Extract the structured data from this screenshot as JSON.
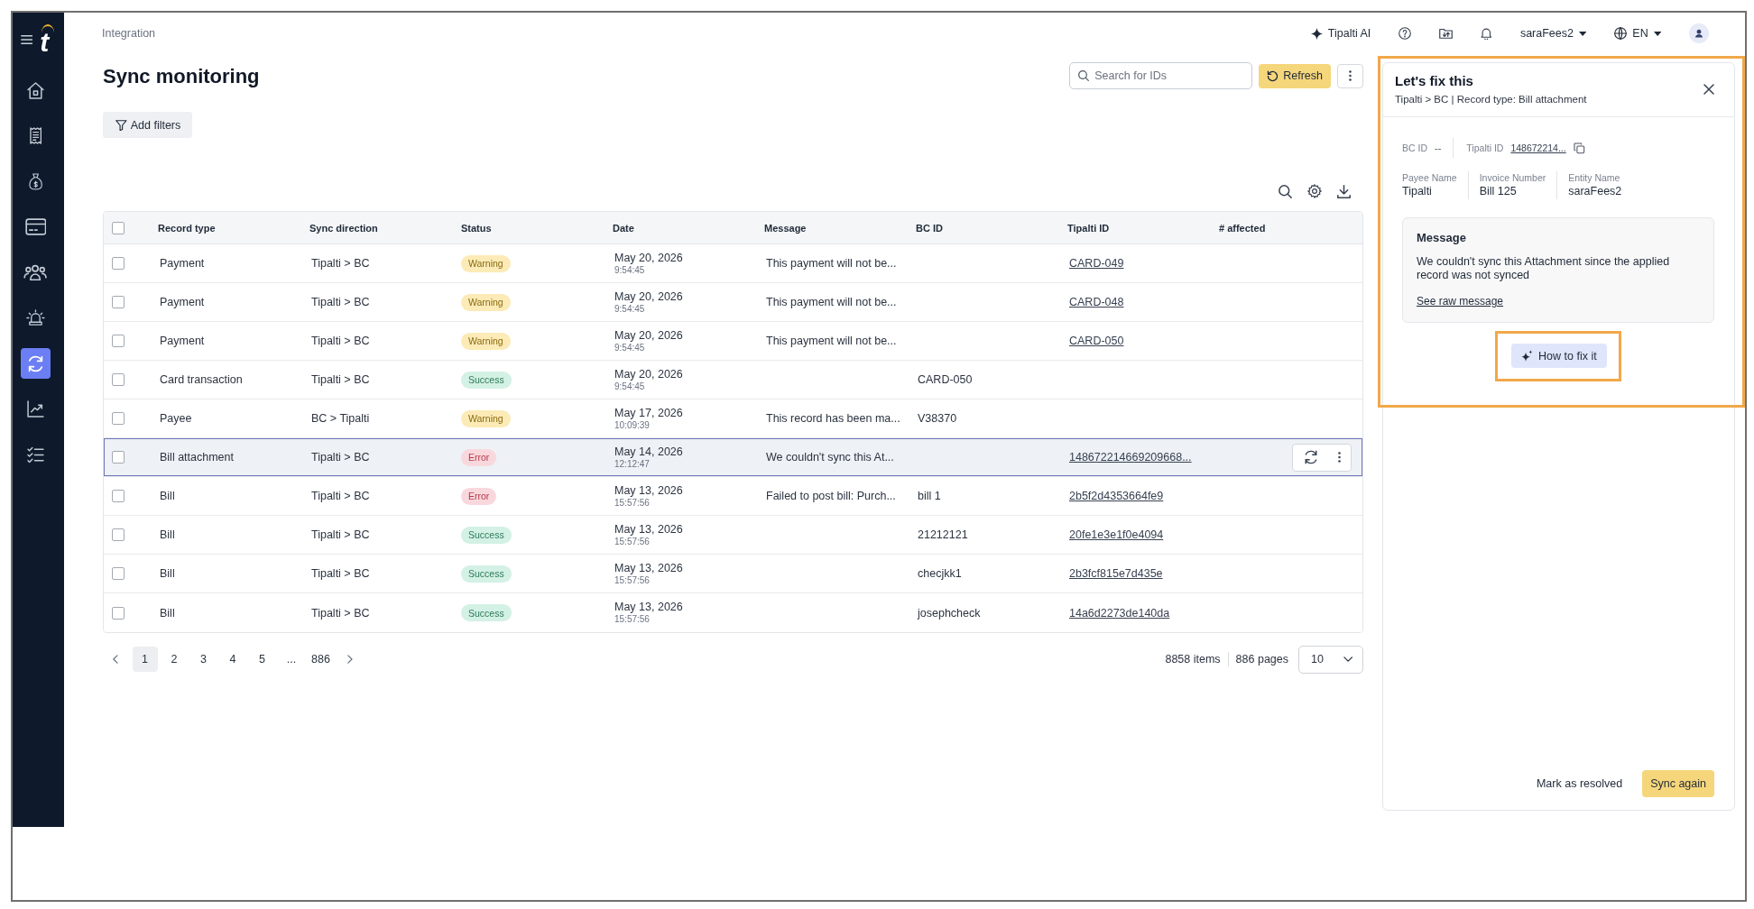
{
  "sidebar": {
    "logo": "t",
    "items": [
      {
        "kind": "home",
        "selected": false
      },
      {
        "kind": "receipt",
        "selected": false
      },
      {
        "kind": "moneybag",
        "selected": false
      },
      {
        "kind": "card",
        "selected": false
      },
      {
        "kind": "people",
        "selected": false
      },
      {
        "kind": "alarm",
        "selected": false
      },
      {
        "kind": "sync",
        "selected": true
      },
      {
        "kind": "chart",
        "selected": false
      },
      {
        "kind": "checklist",
        "selected": false
      }
    ]
  },
  "top_bar": {
    "breadcrumb": "Integration",
    "ai_button": "Tipalti AI",
    "account_menu": "saraFees2",
    "language_menu": "EN"
  },
  "page": {
    "title": "Sync monitoring",
    "search": {
      "placeholder": "Search for IDs"
    },
    "refresh_button": "Refresh",
    "add_filters_button": "Add filters"
  },
  "table": {
    "header_checked": false,
    "columns": [
      "Record type",
      "Sync direction",
      "Status",
      "Date",
      "Message",
      "BC ID",
      "Tipalti ID",
      "# affected"
    ],
    "rows": [
      {
        "checked": false,
        "selected": false,
        "record_type": "Payment",
        "sync_direction": "Tipalti > BC",
        "status": {
          "kind": "warning",
          "label": "Warning"
        },
        "date": "May 20, 2026",
        "time": "9:54:45",
        "message": "This payment will not be...",
        "tipalti_id": "CARD-049"
      },
      {
        "checked": false,
        "selected": false,
        "record_type": "Payment",
        "sync_direction": "Tipalti > BC",
        "status": {
          "kind": "warning",
          "label": "Warning"
        },
        "date": "May 20, 2026",
        "time": "9:54:45",
        "message": "This payment will not be...",
        "tipalti_id": "CARD-048"
      },
      {
        "checked": false,
        "selected": false,
        "record_type": "Payment",
        "sync_direction": "Tipalti > BC",
        "status": {
          "kind": "warning",
          "label": "Warning"
        },
        "date": "May 20, 2026",
        "time": "9:54:45",
        "message": "This payment will not be...",
        "tipalti_id": "CARD-050"
      },
      {
        "checked": false,
        "selected": false,
        "record_type": "Card transaction",
        "sync_direction": "Tipalti > BC",
        "status": {
          "kind": "success",
          "label": "Success"
        },
        "date": "May 20, 2026",
        "time": "9:54:45",
        "bc_id": "CARD-050"
      },
      {
        "checked": false,
        "selected": false,
        "record_type": "Payee",
        "sync_direction": "BC > Tipalti",
        "status": {
          "kind": "warning",
          "label": "Warning"
        },
        "date": "May 17, 2026",
        "time": "10:09:39",
        "message": "This record has been ma...",
        "bc_id": "V38370"
      },
      {
        "checked": false,
        "selected": true,
        "record_type": "Bill attachment",
        "sync_direction": "Tipalti > BC",
        "status": {
          "kind": "error",
          "label": "Error"
        },
        "date": "May 14, 2026",
        "time": "12:12:47",
        "message": "We couldn't sync this At...",
        "tipalti_id": "148672214669209668..."
      },
      {
        "checked": false,
        "selected": false,
        "record_type": "Bill",
        "sync_direction": "Tipalti > BC",
        "status": {
          "kind": "error",
          "label": "Error"
        },
        "date": "May 13, 2026",
        "time": "15:57:56",
        "message": "Failed to post bill: Purch...",
        "bc_id": "bill 1",
        "tipalti_id": "2b5f2d4353664fe9"
      },
      {
        "checked": false,
        "selected": false,
        "record_type": "Bill",
        "sync_direction": "Tipalti > BC",
        "status": {
          "kind": "success",
          "label": "Success"
        },
        "date": "May 13, 2026",
        "time": "15:57:56",
        "bc_id": "21212121",
        "tipalti_id": "20fe1e3e1f0e4094"
      },
      {
        "checked": false,
        "selected": false,
        "record_type": "Bill",
        "sync_direction": "Tipalti > BC",
        "status": {
          "kind": "success",
          "label": "Success"
        },
        "date": "May 13, 2026",
        "time": "15:57:56",
        "bc_id": "checjkk1",
        "tipalti_id": "2b3fcf815e7d435e"
      },
      {
        "checked": false,
        "selected": false,
        "record_type": "Bill",
        "sync_direction": "Tipalti > BC",
        "status": {
          "kind": "success",
          "label": "Success"
        },
        "date": "May 13, 2026",
        "time": "15:57:56",
        "bc_id": "josephcheck",
        "tipalti_id": "14a6d2273de140da"
      }
    ]
  },
  "pagination": {
    "pages": [
      {
        "label": "1",
        "selected": true
      },
      {
        "label": "2",
        "selected": false
      },
      {
        "label": "3",
        "selected": false
      },
      {
        "label": "4",
        "selected": false
      },
      {
        "label": "5",
        "selected": false
      },
      {
        "label": "...",
        "selected": false
      },
      {
        "label": "886",
        "selected": false
      }
    ],
    "total_items": "8858 items",
    "total_pages": "886 pages",
    "page_size": "10"
  },
  "panel": {
    "highlighted": true,
    "title": "Let's fix this",
    "subtitle": "Tipalti > BC | Record type: Bill attachment",
    "id_fields": [
      {
        "kind": "text",
        "label": "BC ID",
        "value": "--"
      },
      {
        "kind": "link",
        "label": "Tipalti ID",
        "value": "148672214..."
      }
    ],
    "detail_fields": [
      {
        "label": "Payee Name",
        "value": "Tipalti"
      },
      {
        "label": "Invoice Number",
        "value": "Bill 125"
      },
      {
        "label": "Entity Name",
        "value": "saraFees2"
      }
    ],
    "message": {
      "title": "Message",
      "text": "We couldn't sync this Attachment since the applied record was not synced",
      "link": "See raw message"
    },
    "how_to_fix_button": {
      "label": "How to fix it",
      "highlighted": true
    },
    "resolve_button": "Mark as resolved",
    "sync_button": "Sync again"
  }
}
